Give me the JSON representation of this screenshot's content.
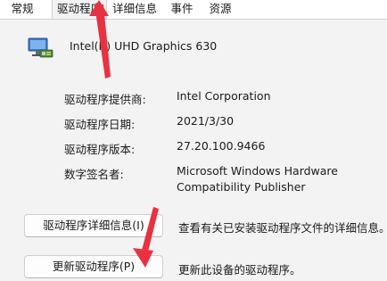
{
  "tabs": [
    "常规",
    "驱动程序",
    "详细信息",
    "事件",
    "资源"
  ],
  "device": {
    "name": "Intel(R) UHD Graphics 630",
    "icon": "display-adapter-icon"
  },
  "props": [
    {
      "label": "驱动程序提供商:",
      "value": "Intel Corporation"
    },
    {
      "label": "驱动程序日期:",
      "value": "2021/3/30"
    },
    {
      "label": "驱动程序版本:",
      "value": "27.20.100.9466"
    },
    {
      "label": "数字签名者:",
      "value_line1": "Microsoft Windows Hardware",
      "value_line2": "Compatibility Publisher"
    }
  ],
  "buttons": {
    "details": {
      "label": "驱动程序详细信息(I)",
      "description": "查看有关已安装驱动程序文件的详细信息。"
    },
    "update": {
      "label": "更新驱动程序(P)",
      "description": "更新此设备的驱动程序。"
    }
  },
  "colors": {
    "annotation_arrow": "#e8323f",
    "active_tab_bg": "#f3f3f3"
  }
}
